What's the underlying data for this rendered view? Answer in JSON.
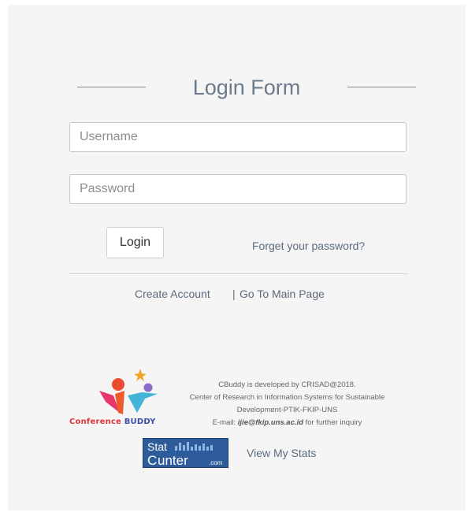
{
  "form": {
    "title": "Login Form",
    "username_placeholder": "Username",
    "password_placeholder": "Password",
    "login_label": "Login",
    "forget_label": "Forget your password?"
  },
  "links": {
    "create_account": "Create Account",
    "separator": "|",
    "go_main": "Go To Main Page"
  },
  "footer": {
    "logo_word1": "Conference",
    "logo_word2": "BUDDY",
    "line1": "CBuddy is developed by CRISAD@2018.",
    "line2": "Center of Research in Information Systems for Sustainable",
    "line3": "Development-PTIK-FKIP-UNS",
    "email_prefix": "E-mail: ",
    "email": "ijie@fkip.uns.ac.id",
    "email_suffix": " for further inquiry",
    "stat_top": "Stat",
    "stat_c": "C",
    "stat_unter": "unter",
    "stat_com": ".com",
    "view_stats": "View My Stats"
  },
  "colors": {
    "panel_bg": "#f5f5f5",
    "title": "#6b7a8b",
    "link": "#5b6b7c",
    "logo_red": "#e0343d",
    "logo_blue": "#3d4aa8",
    "statcounter_bg": "#2e5b9a"
  }
}
